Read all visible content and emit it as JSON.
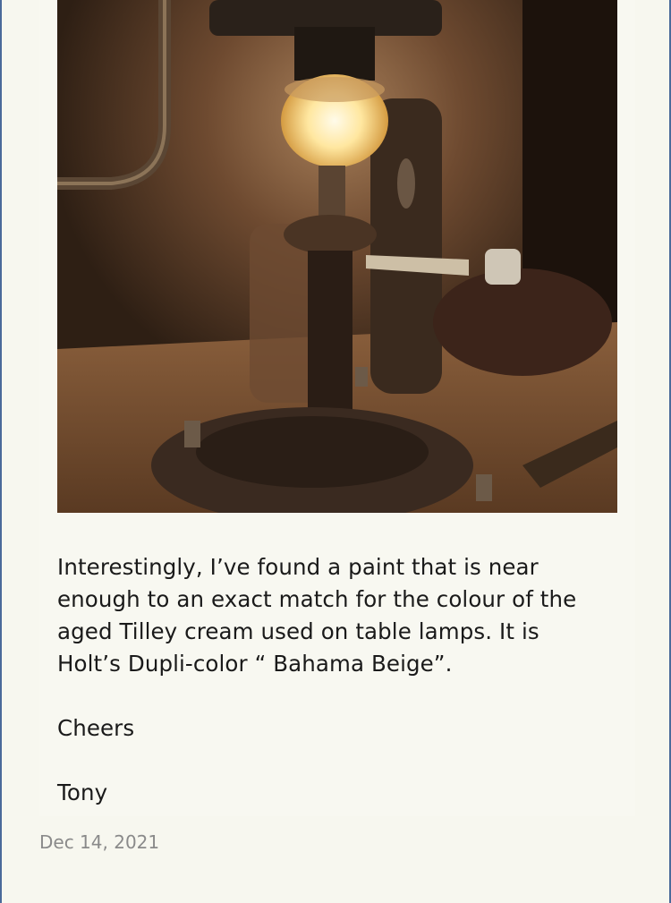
{
  "post": {
    "image_alt": "",
    "paragraph1_line1": "Interestingly, I’ve found a paint that is near",
    "paragraph1_line2": "enough to an exact match for the colour of the",
    "paragraph1_line3": "aged Tilley cream used on table lamps. It is",
    "paragraph1_line4": "Holt’s Dupli-color “ Bahama Beige”.",
    "signoff": "Cheers",
    "author": "Tony",
    "date": "Dec 14, 2021"
  },
  "colors": {
    "background": "#f7f7ef",
    "frame_border": "#4a6a9a",
    "text": "#1a1a1a",
    "date_text": "#8a8a8a"
  }
}
